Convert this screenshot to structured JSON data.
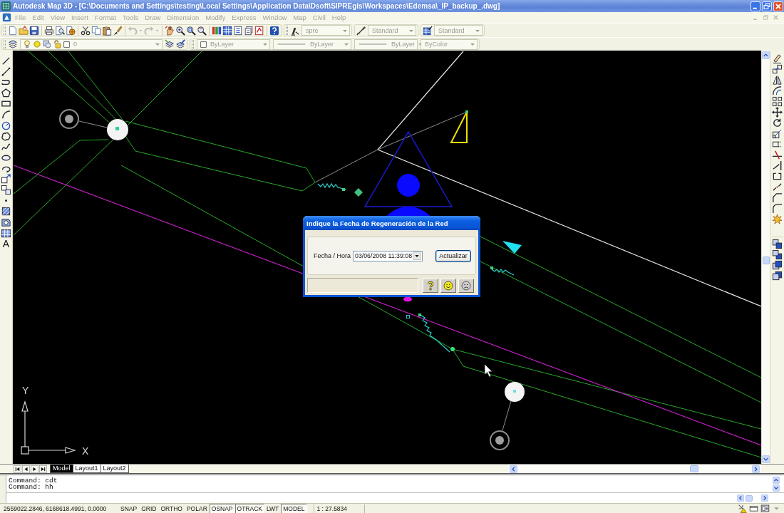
{
  "window": {
    "title": "Autodesk Map 3D - [C:\\Documents and Settings\\testing\\Local Settings\\Application Data\\Dsoft\\SIPREgis\\Workspaces\\Edemsa\\_IP_backup_.dwg]"
  },
  "menu": [
    {
      "label": "File",
      "disabled": true
    },
    {
      "label": "Edit",
      "disabled": true
    },
    {
      "label": "View",
      "disabled": true
    },
    {
      "label": "Insert",
      "disabled": true
    },
    {
      "label": "Format",
      "disabled": true
    },
    {
      "label": "Tools",
      "disabled": true
    },
    {
      "label": "Draw",
      "disabled": true
    },
    {
      "label": "Dimension",
      "disabled": true
    },
    {
      "label": "Modify",
      "disabled": true
    },
    {
      "label": "Express",
      "disabled": true
    },
    {
      "label": "Window",
      "disabled": true
    },
    {
      "label": "Map",
      "disabled": true
    },
    {
      "label": "Civil",
      "disabled": true
    },
    {
      "label": "Help",
      "disabled": true
    }
  ],
  "styles_toolbar": {
    "text_style": {
      "value": "spre",
      "disabled": true
    },
    "dimension_style": {
      "value": "Standard",
      "disabled": true
    },
    "table_style": {
      "value": "Standard",
      "disabled": true
    }
  },
  "layers_toolbar": {
    "layer": {
      "value": "0",
      "disabled": true
    }
  },
  "properties_toolbar": {
    "color": {
      "value": "ByLayer",
      "disabled": true
    },
    "linetype": {
      "value": "ByLayer",
      "disabled": true
    },
    "lineweight": {
      "value": "ByLayer",
      "disabled": true
    },
    "plot_style": {
      "value": "ByColor",
      "disabled": true
    }
  },
  "draw_toolbar": {
    "text_tool": "A"
  },
  "canvas": {
    "ucs": {
      "y_label": "Y",
      "x_label": "X"
    }
  },
  "dialog": {
    "title": "Indique la Fecha de Regeneración de la Red",
    "field_label": "Fecha / Hora",
    "date_time": "03/06/2008 11:39:08",
    "update_button": "Actualizar"
  },
  "layout_tabs": [
    {
      "label": "Model",
      "selected": true
    },
    {
      "label": "Layout1",
      "selected": false
    },
    {
      "label": "Layout2",
      "selected": false
    }
  ],
  "command_history": [
    "Command: cdt",
    "Command: hh"
  ],
  "status_bar": {
    "coordinates": "2559022.2846, 6168618.4991, 0.0000",
    "toggles": [
      {
        "label": "SNAP",
        "on": false
      },
      {
        "label": "GRID",
        "on": false
      },
      {
        "label": "ORTHO",
        "on": false
      },
      {
        "label": "POLAR",
        "on": false
      },
      {
        "label": "OSNAP",
        "on": true
      },
      {
        "label": "OTRACK",
        "on": true
      },
      {
        "label": "LWT",
        "on": false
      },
      {
        "label": "MODEL",
        "on": true
      }
    ],
    "scale": "1 : 27.5834"
  }
}
